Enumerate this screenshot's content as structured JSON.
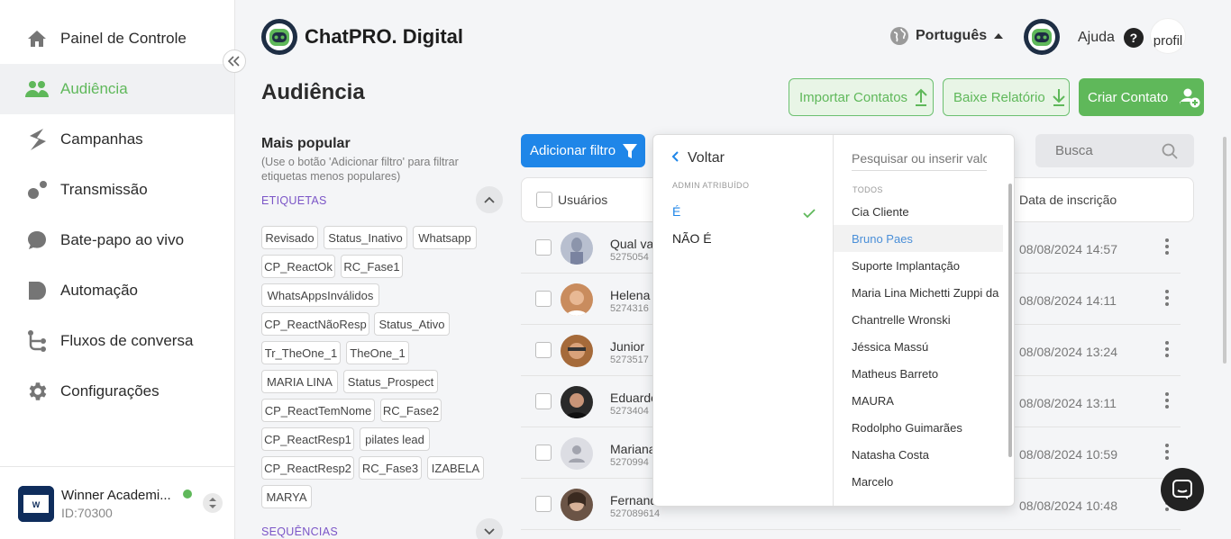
{
  "sidebar": {
    "items": [
      {
        "label": "Painel de Controle",
        "icon": "home-icon"
      },
      {
        "label": "Audiência",
        "icon": "users-icon"
      },
      {
        "label": "Campanhas",
        "icon": "campaign-icon"
      },
      {
        "label": "Transmissão",
        "icon": "broadcast-icon"
      },
      {
        "label": "Bate-papo ao vivo",
        "icon": "chat-bubble-icon"
      },
      {
        "label": "Automação",
        "icon": "automation-icon"
      },
      {
        "label": "Fluxos de conversa",
        "icon": "flow-icon"
      },
      {
        "label": "Configurações",
        "icon": "gear-icon"
      }
    ],
    "active_color": "#5fb85a",
    "account": {
      "name": "Winner Academi...",
      "id": "ID:70300",
      "status_color": "#5fb85a"
    }
  },
  "header": {
    "brand": "ChatPRO. Digital",
    "language": "Português",
    "help": "Ajuda",
    "avatar_alt": "profil"
  },
  "page": {
    "title": "Audiência",
    "import_button": "Importar Contatos",
    "report_button": "Baixe Relatório",
    "create_button": "Criar Contato"
  },
  "filters": {
    "popular_title": "Mais popular",
    "popular_hint": "(Use o botão 'Adicionar filtro' para filtrar etiquetas menos populares)",
    "tags_section": "ETIQUETAS",
    "sequences_section": "SEQUÊNCIAS",
    "tags": [
      "Revisado",
      "Status_Inativo",
      "Whatsapp",
      "CP_ReactOk",
      "RC_Fase1",
      "WhatsAppsInválidos",
      "CP_ReactNãoResp",
      "Status_Ativo",
      "Tr_TheOne_1",
      "TheOne_1",
      "MARIA LINA",
      "Status_Prospect",
      "CP_ReactTemNome",
      "RC_Fase2",
      "CP_ReactResp1",
      "pilates lead",
      "CP_ReactResp2",
      "RC_Fase3",
      "IZABELA",
      "MARYA"
    ]
  },
  "table": {
    "add_filter": "Adicionar filtro",
    "search_placeholder": "Busca",
    "col_users": "Usuários",
    "col_date": "Data de inscrição",
    "rows": [
      {
        "name": "Qual va",
        "phone": "5275054",
        "date": "08/08/2024 14:57"
      },
      {
        "name": "Helena",
        "phone": "5274316",
        "date": "08/08/2024 14:11"
      },
      {
        "name": "Junior",
        "phone": "5273517",
        "date": "08/08/2024 13:24"
      },
      {
        "name": "Eduardo",
        "phone": "5273404",
        "date": "08/08/2024 13:11"
      },
      {
        "name": "Mariana",
        "phone": "5270994",
        "date": "08/08/2024 10:59"
      },
      {
        "name": "Fernand",
        "phone": "527089614",
        "date": "08/08/2024 10:48"
      }
    ]
  },
  "dropdown": {
    "back": "Voltar",
    "subtitle": "ADMIN ATRIBUÍDO",
    "options": [
      "É",
      "NÃO É"
    ],
    "search_placeholder": "Pesquisar ou inserir valor",
    "all_label": "TODOS",
    "people": [
      "Cia Cliente",
      "Bruno Paes",
      "Suporte Implantação",
      "Maria Lina Michetti Zuppi da",
      "Chantrelle Wronski",
      "Jéssica Massú",
      "Matheus Barreto",
      "MAURA",
      "Rodolpho Guimarães",
      "Natasha Costa",
      "Marcelo"
    ]
  },
  "colors": {
    "accent_green": "#5fb85a",
    "primary_blue": "#1f86e8",
    "section_purple": "#7b55c7"
  }
}
